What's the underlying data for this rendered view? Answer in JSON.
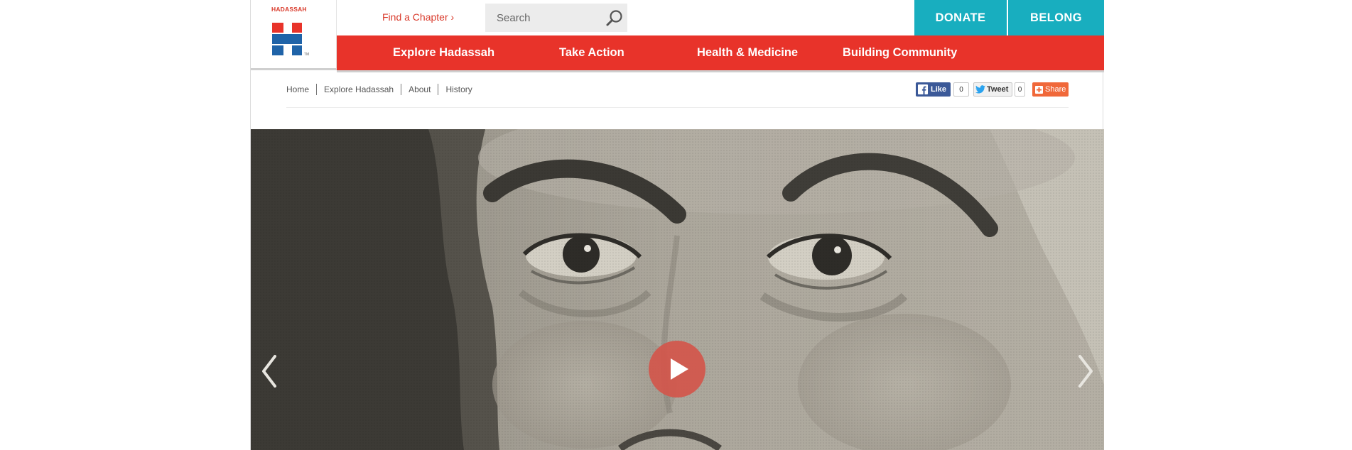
{
  "brand": {
    "name": "HADASSAH",
    "colors": {
      "red": "#e8332a",
      "blue": "#1f63a8",
      "teal": "#18aebf"
    }
  },
  "header": {
    "find_chapter": "Find a Chapter ›",
    "search": {
      "placeholder": "Search",
      "icon": "search-icon"
    },
    "donate": "DONATE",
    "belong": "BELONG"
  },
  "nav": {
    "items": [
      {
        "label": "Explore Hadassah"
      },
      {
        "label": "Take Action"
      },
      {
        "label": "Health & Medicine"
      },
      {
        "label": "Building Community"
      }
    ]
  },
  "breadcrumb": [
    "Home",
    "Explore Hadassah",
    "About",
    "History"
  ],
  "social": {
    "like": "Like",
    "like_count": "0",
    "tweet": "Tweet",
    "tweet_count": "0",
    "share": "Share"
  },
  "hero": {
    "play_icon": "play-icon",
    "prev_icon": "chevron-left-icon",
    "next_icon": "chevron-right-icon"
  }
}
